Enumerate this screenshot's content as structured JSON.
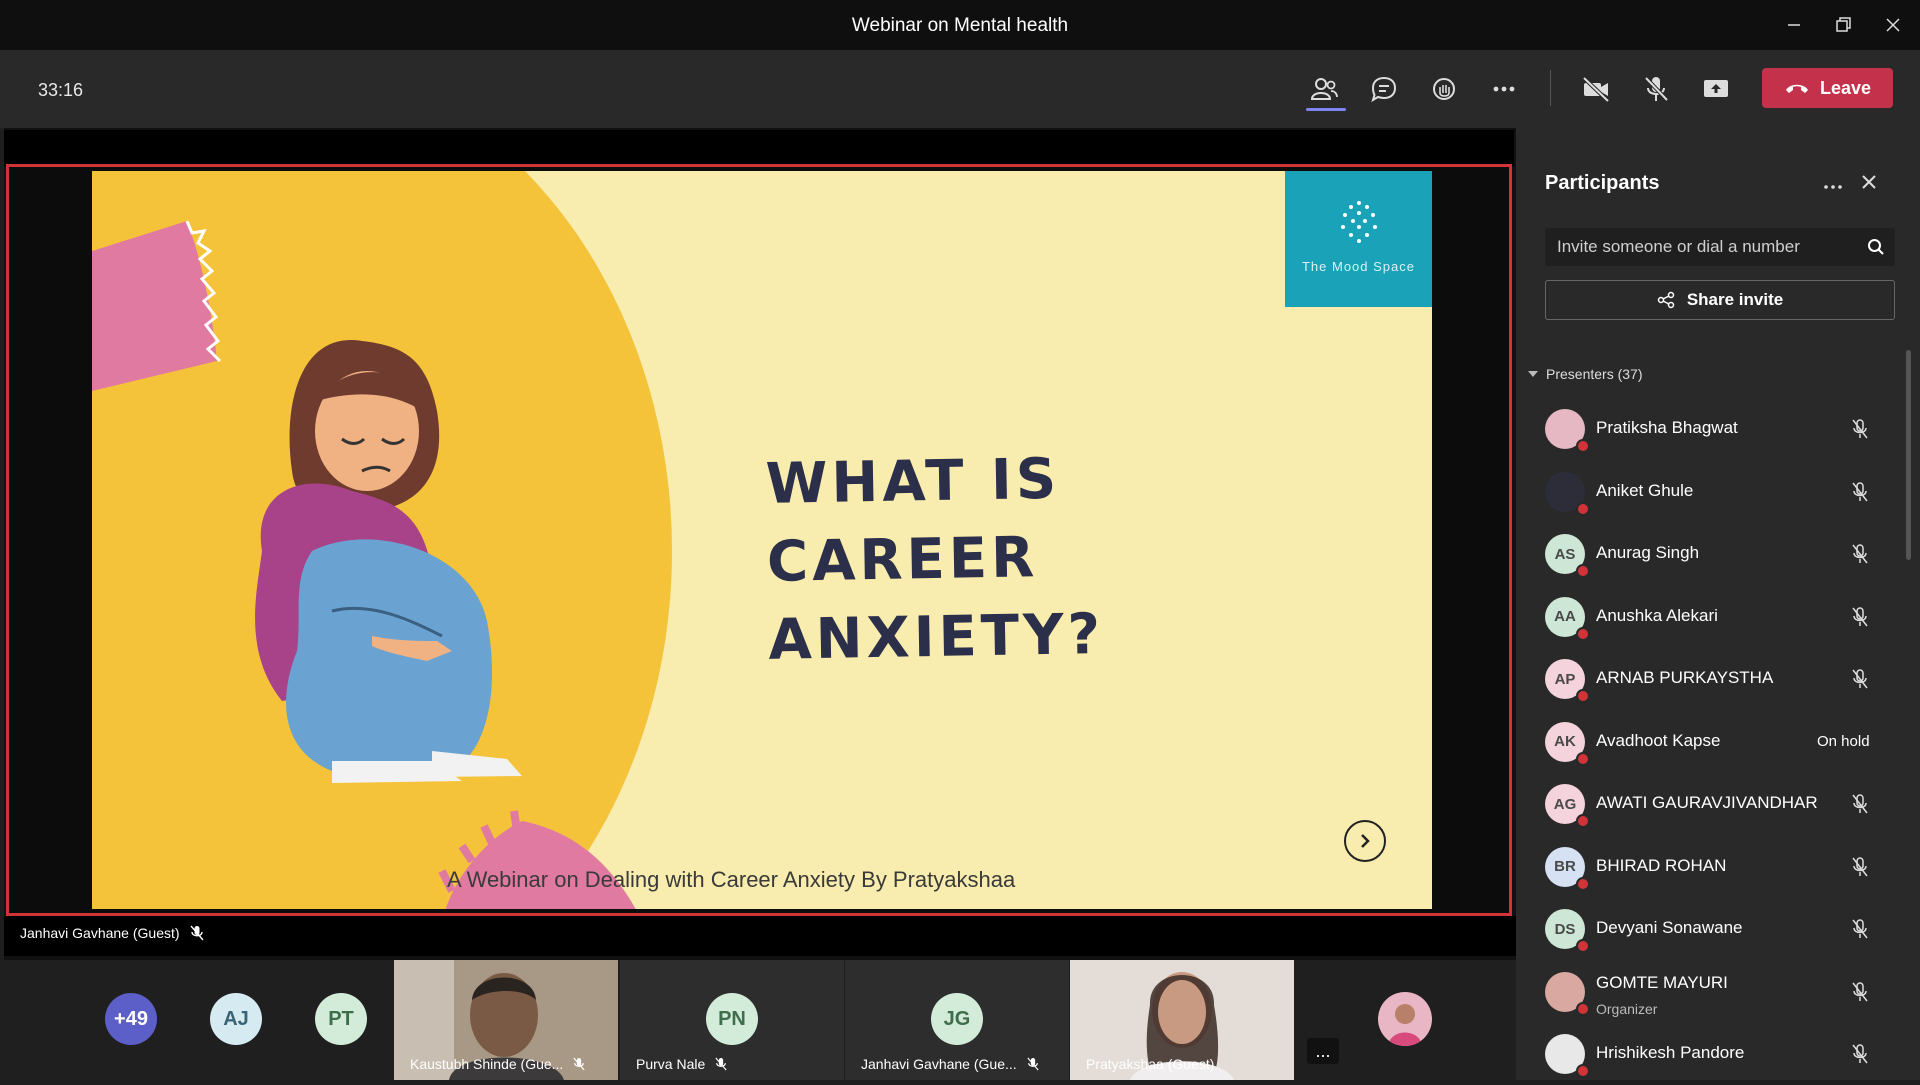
{
  "window": {
    "title": "Webinar on Mental health"
  },
  "toolbar": {
    "timer": "33:16",
    "leave_label": "Leave"
  },
  "slide": {
    "title_line1": "WHAT IS CAREER",
    "title_line2": "ANXIETY?",
    "subtitle": "A Webinar on Dealing with Career Anxiety  By Pratyakshaa",
    "brand": "The Mood Space"
  },
  "presenter_label": "Janhavi Gavhane (Guest)",
  "gallery": {
    "overflow_count": "+49",
    "avatars": [
      "AJ",
      "PT"
    ],
    "tiles": [
      {
        "initials": "",
        "name": "Kaustubh Shinde (Gue..."
      },
      {
        "initials": "PN",
        "name": "Purva Nale"
      },
      {
        "initials": "JG",
        "name": "Janhavi Gavhane (Gue..."
      },
      {
        "initials": "",
        "name": "Pratyakshaa (Guest)"
      }
    ],
    "more_label": "..."
  },
  "panel": {
    "title": "Participants",
    "invite_placeholder": "Invite someone or dial a number",
    "share_invite_label": "Share invite",
    "presenters_header": "Presenters (37)",
    "participants": [
      {
        "initials": "",
        "name": "Pratiksha Bhagwat",
        "role": "",
        "status": "",
        "color": "#e6b8c4"
      },
      {
        "initials": "",
        "name": "Aniket Ghule",
        "role": "",
        "status": "",
        "color": "#2d2d3a"
      },
      {
        "initials": "AS",
        "name": "Anurag Singh",
        "role": "",
        "status": "",
        "color": "#cde6d6"
      },
      {
        "initials": "AA",
        "name": "Anushka Alekari",
        "role": "",
        "status": "",
        "color": "#cde6d6"
      },
      {
        "initials": "AP",
        "name": "ARNAB PURKAYSTHA",
        "role": "",
        "status": "",
        "color": "#f4d3dc"
      },
      {
        "initials": "AK",
        "name": "Avadhoot Kapse",
        "role": "",
        "status": "On hold",
        "color": "#f4d3dc"
      },
      {
        "initials": "AG",
        "name": "AWATI GAURAVJIVANDHAR",
        "role": "",
        "status": "",
        "color": "#f4d3dc"
      },
      {
        "initials": "BR",
        "name": "BHIRAD ROHAN",
        "role": "",
        "status": "",
        "color": "#d6e2f4"
      },
      {
        "initials": "DS",
        "name": "Devyani Sonawane",
        "role": "",
        "status": "",
        "color": "#cde6d6"
      },
      {
        "initials": "",
        "name": "GOMTE MAYURI",
        "role": "Organizer",
        "status": "",
        "color": "#d9a8a0"
      },
      {
        "initials": "",
        "name": "Hrishikesh Pandore",
        "role": "",
        "status": "",
        "color": "#e8e8e8"
      }
    ]
  },
  "colors": {
    "leave": "#c4314b",
    "accent": "#7f85f5",
    "share_border": "#d13438",
    "slide_bg": "#f8ecae",
    "slide_yellow": "#f4c33a",
    "brand_teal": "#1aa2b8"
  }
}
